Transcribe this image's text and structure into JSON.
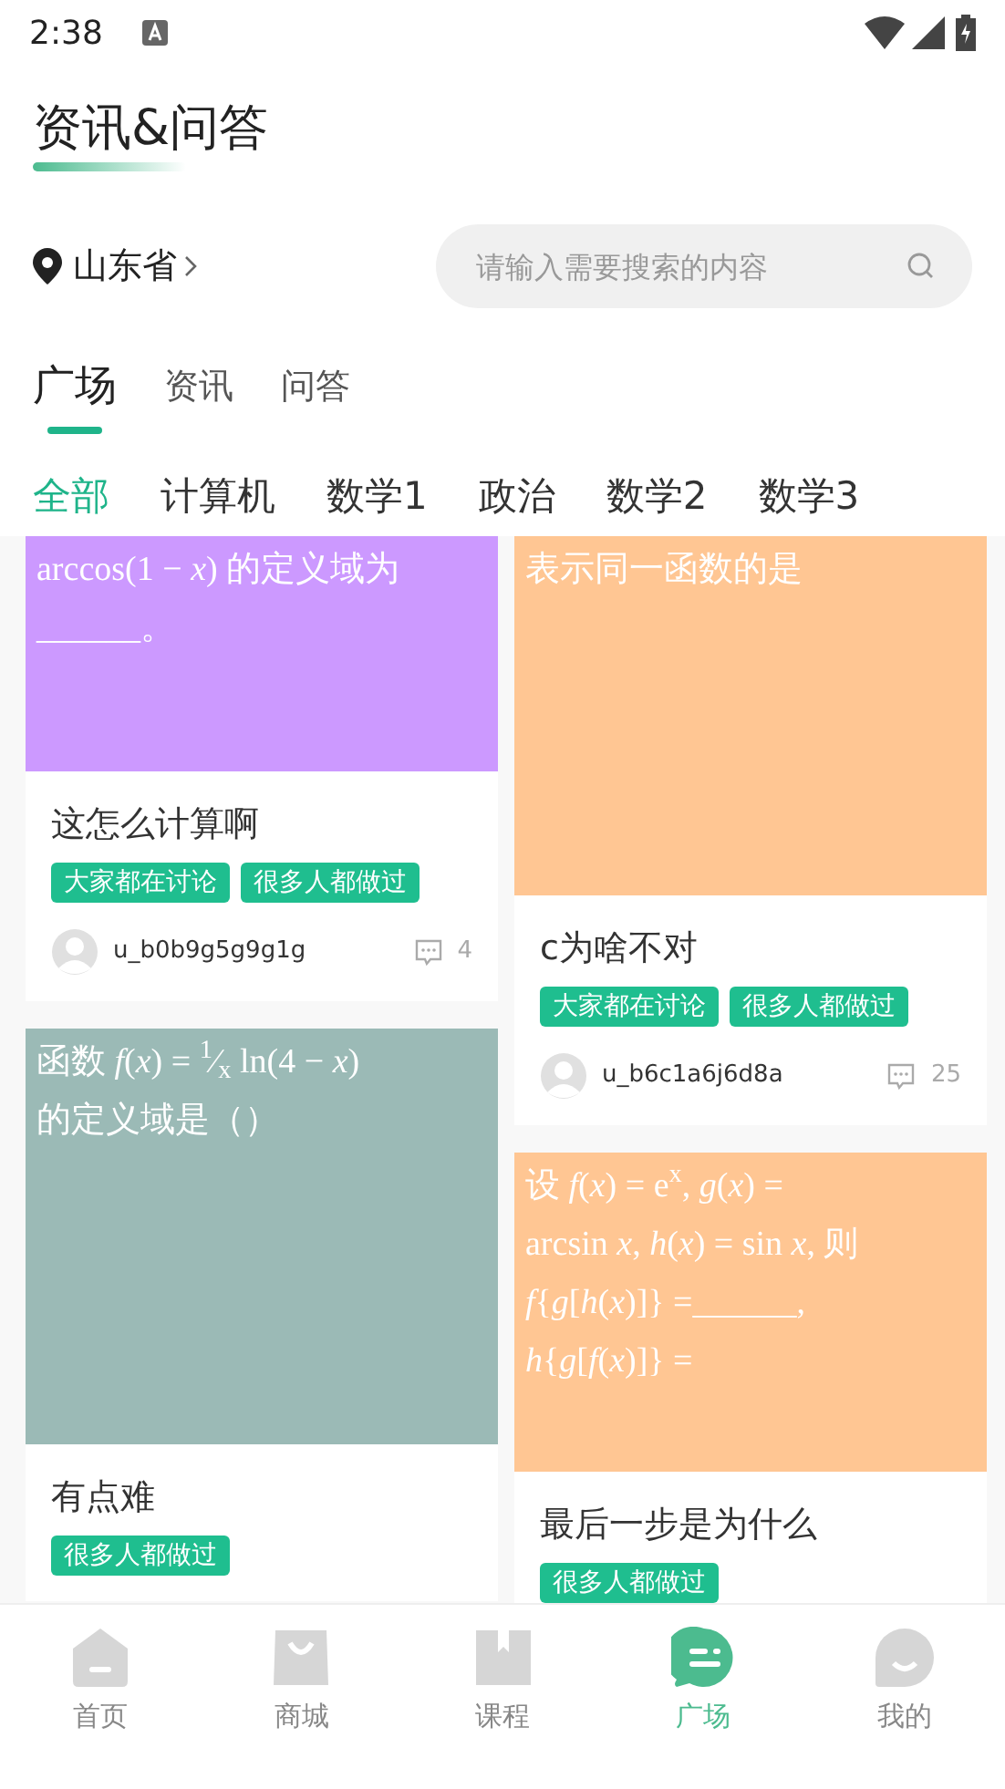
{
  "status_bar": {
    "time": "2:38"
  },
  "header": {
    "title": "资讯&问答"
  },
  "location": {
    "label": "山东省"
  },
  "search": {
    "placeholder": "请输入需要搜索的内容"
  },
  "tabs": [
    {
      "label": "广场",
      "selected": true
    },
    {
      "label": "资讯",
      "selected": false
    },
    {
      "label": "问答",
      "selected": false
    }
  ],
  "categories": [
    {
      "label": "全部",
      "selected": true
    },
    {
      "label": "计算机",
      "selected": false
    },
    {
      "label": "数学1",
      "selected": false
    },
    {
      "label": "政治",
      "selected": false
    },
    {
      "label": "数学2",
      "selected": false
    },
    {
      "label": "数学3",
      "selected": false
    }
  ],
  "columns": [
    [
      {
        "color": "#cc99ff",
        "lines": [
          "arccos(1 − *x*) 的定义域为",
          "______。"
        ],
        "title": "这怎么计算啊",
        "tags": [
          "大家都在讨论",
          "很多人都做过"
        ],
        "user": "u_b0b9g5g9g1g",
        "comments": "4"
      },
      {
        "color": "#9bbab6",
        "lines": [
          "函数 *f*(*x*) = $^{1}$⁄$_{x}$ ln(4 − *x*)",
          "的定义域是（）"
        ],
        "title": "有点难",
        "tags": [
          "很多人都做过"
        ]
      }
    ],
    [
      {
        "color": "#ffc693",
        "lines": [
          "表示同一函数的是"
        ],
        "title": "c为啥不对",
        "tags": [
          "大家都在讨论",
          "很多人都做过"
        ],
        "user": "u_b6c1a6j6d8a",
        "comments": "25"
      },
      {
        "color": "#ffc693",
        "lines": [
          "设 *f*(*x*) = e$^{x}$, *g*(*x*) =",
          "arcsin *x*, *h*(*x*) = sin *x*, 则",
          "*f*{*g*[*h*(*x*)]} =______,",
          "*h*{*g*[*f*(*x*)]} ="
        ],
        "title": "最后一步是为什么",
        "tags": [
          "很多人都做过"
        ]
      }
    ]
  ],
  "nav": [
    {
      "kind": "home",
      "label": "首页",
      "selected": false
    },
    {
      "kind": "shop",
      "label": "商城",
      "selected": false
    },
    {
      "kind": "course",
      "label": "课程",
      "selected": false
    },
    {
      "kind": "square",
      "label": "广场",
      "selected": true
    },
    {
      "kind": "me",
      "label": "我的",
      "selected": false
    }
  ]
}
